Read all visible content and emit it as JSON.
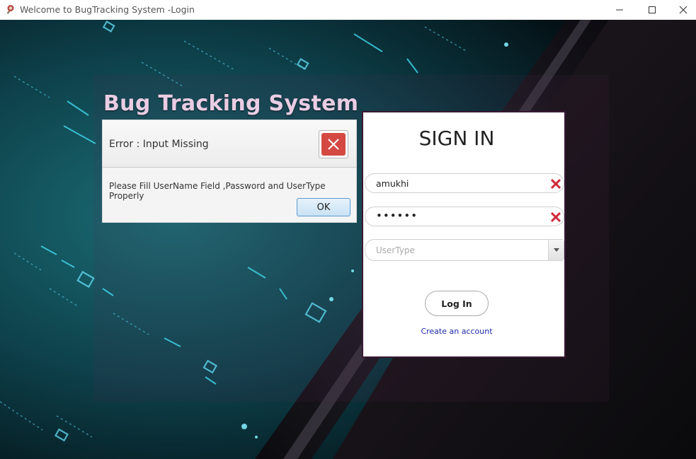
{
  "window": {
    "title": "Welcome to BugTracking System -Login",
    "minimize_glyph": "—",
    "maximize_glyph": "☐",
    "close_glyph": "✕"
  },
  "heading": "Bug Tracking System",
  "error_dialog": {
    "title": "Error : Input Missing",
    "message": "Please Fill UserName Field ,Password and UserType Properly",
    "ok_label": "OK",
    "close_icon": "close-icon"
  },
  "signin": {
    "title": "SIGN IN",
    "username_value": "amukhi",
    "password_value": "••••••",
    "usertype_placeholder": "UserType",
    "login_label": "Log In",
    "create_account_label": "Create an account"
  },
  "colors": {
    "heading": "#e9cde4",
    "error_close": "#d44a43",
    "clear_icon": "#d0283a",
    "link": "#1e2aa8",
    "panel_border": "#3a1934"
  }
}
